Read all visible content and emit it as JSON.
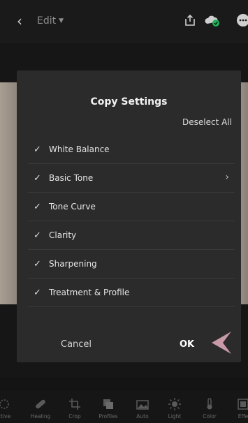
{
  "header": {
    "edit_label": "Edit"
  },
  "dialog": {
    "title": "Copy Settings",
    "deselect_label": "Deselect All",
    "items": [
      {
        "label": "White Balance",
        "checked": true,
        "has_submenu": false
      },
      {
        "label": "Basic Tone",
        "checked": true,
        "has_submenu": true
      },
      {
        "label": "Tone Curve",
        "checked": true,
        "has_submenu": false
      },
      {
        "label": "Clarity",
        "checked": true,
        "has_submenu": false
      },
      {
        "label": "Sharpening",
        "checked": true,
        "has_submenu": false
      },
      {
        "label": "Treatment & Profile",
        "checked": true,
        "has_submenu": false
      }
    ],
    "cancel_label": "Cancel",
    "ok_label": "OK"
  },
  "toolbar": {
    "tools": [
      {
        "label": "ctive",
        "icon": "selective-icon"
      },
      {
        "label": "Healing",
        "icon": "healing-icon"
      },
      {
        "label": "Crop",
        "icon": "crop-icon"
      },
      {
        "label": "Profiles",
        "icon": "profiles-icon"
      },
      {
        "label": "Auto",
        "icon": "auto-icon"
      },
      {
        "label": "Light",
        "icon": "light-icon"
      },
      {
        "label": "Color",
        "icon": "color-icon"
      },
      {
        "label": "Effe",
        "icon": "effects-icon"
      }
    ]
  },
  "colors": {
    "accent_sync": "#1fb35a",
    "pointer": "#c89aa8"
  }
}
